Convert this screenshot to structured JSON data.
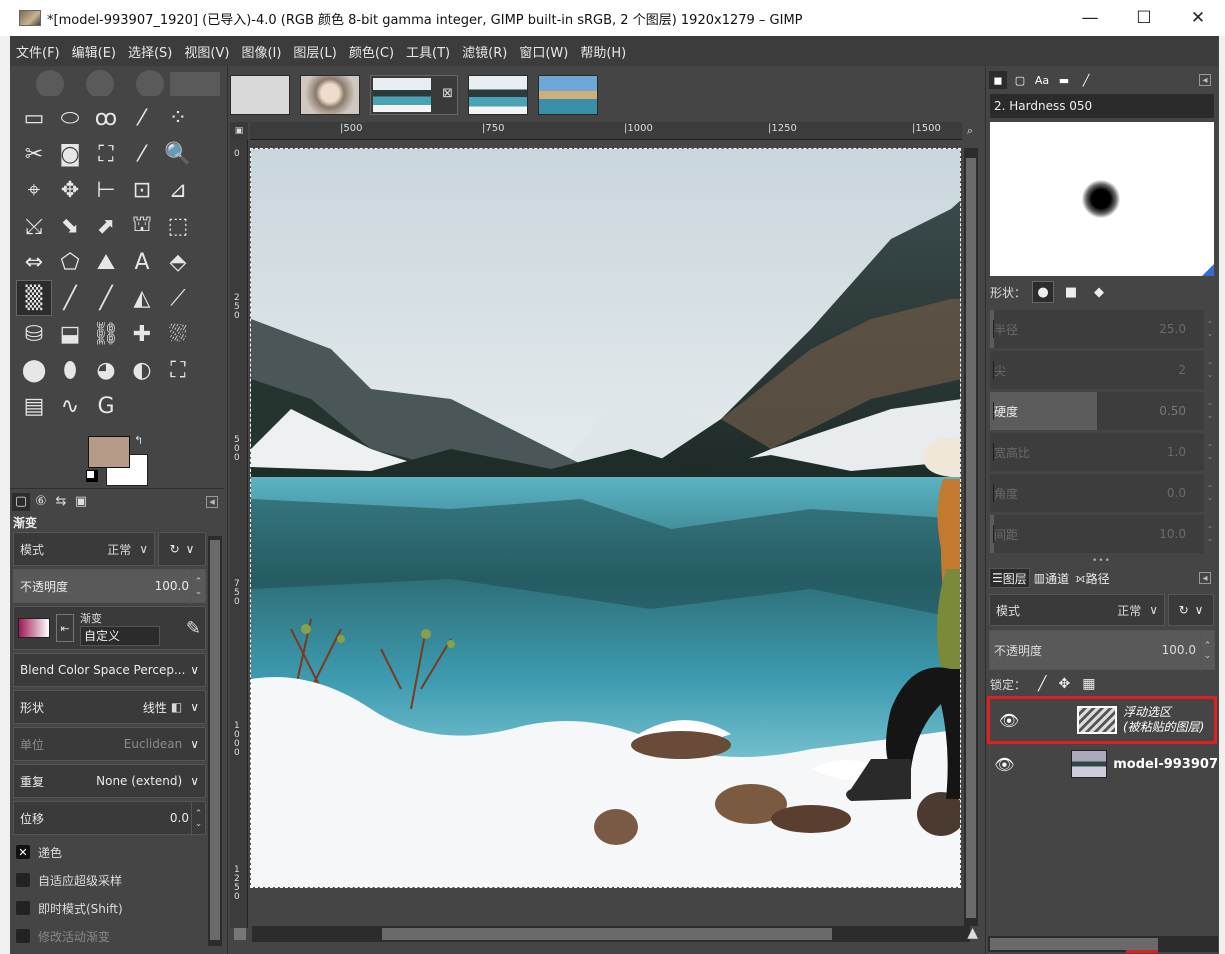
{
  "window": {
    "title": "*[model-993907_1920] (已导入)-4.0 (RGB 颜色 8-bit gamma integer, GIMP built-in sRGB, 2 个图层) 1920x1279 – GIMP",
    "minimize": "—",
    "maximize": "☐",
    "close": "✕"
  },
  "menubar": [
    "文件(F)",
    "编辑(E)",
    "选择(S)",
    "视图(V)",
    "图像(I)",
    "图层(L)",
    "颜色(C)",
    "工具(T)",
    "滤镜(R)",
    "窗口(W)",
    "帮助(H)"
  ],
  "toolbox": {
    "tools": [
      "▭",
      "⬭",
      "ꝏ",
      "⁄",
      "⁘",
      "✂",
      "◙",
      "⛶",
      "⁄",
      "🔍",
      "⌖",
      "✥",
      "⊢",
      "⊡",
      "⊿",
      "⤩",
      "⬊",
      "⬈",
      "⛫",
      "⬚",
      "⇔",
      "⬠",
      "⛰",
      "A",
      "⬘",
      "▒",
      "╱",
      "╱",
      "◭",
      "⟋",
      "⛁",
      "⬓",
      "⛓",
      "✚",
      "⛆",
      "⬤",
      "⬮",
      "◕",
      "◐",
      "⛶",
      "▤",
      "∿",
      "G"
    ],
    "active_tool_index": 25,
    "fg_color": "#b59a88",
    "bg_color": "#ffffff",
    "swap_icon": "↰"
  },
  "tool_options": {
    "tabs": [
      "▢",
      "⑥",
      "⇆",
      "▣"
    ],
    "menu_arrow": "◂",
    "title": "渐变",
    "mode_label": "模式",
    "mode_value": "正常",
    "opacity_label": "不透明度",
    "opacity_value": "100.0",
    "gradient_label": "渐变",
    "gradient_value": "自定义",
    "blend_space": "Blend Color Space Percep...",
    "shape_label": "形状",
    "shape_value": "线性",
    "metric_label": "单位",
    "metric_value": "Euclidean",
    "repeat_label": "重复",
    "repeat_value": "None (extend)",
    "offset_label": "位移",
    "offset_value": "0.0",
    "checkboxes": [
      {
        "label": "递色",
        "checked": true
      },
      {
        "label": "自适应超级采样",
        "checked": false
      },
      {
        "label": "即时模式(Shift)",
        "checked": false
      },
      {
        "label": "修改活动渐变",
        "checked": false
      }
    ]
  },
  "image_tabs": {
    "close_icon": "⊠"
  },
  "rulers": {
    "top": [
      "|500",
      "|750",
      "|1000",
      "|1250",
      "|1500"
    ],
    "left": [
      "0",
      "250",
      "500",
      "750",
      "1000",
      "1250"
    ]
  },
  "brushes": {
    "brush_name": "2. Hardness 050",
    "shape_label": "形状：",
    "sliders": [
      {
        "label": "半径",
        "value": "25.0",
        "active": false,
        "fill": 0.02
      },
      {
        "label": "尖",
        "value": "2",
        "active": false,
        "fill": 0
      },
      {
        "label": "硬度",
        "value": "0.50",
        "active": true,
        "fill": 0.5
      },
      {
        "label": "宽高比",
        "value": "1.0",
        "active": false,
        "fill": 0
      },
      {
        "label": "角度",
        "value": "0.0",
        "active": false,
        "fill": 0
      },
      {
        "label": "间距",
        "value": "10.0",
        "active": false,
        "fill": 0.02
      }
    ]
  },
  "layers": {
    "tabs": [
      "图层",
      "通道",
      "路径"
    ],
    "tab_icons": [
      "☰",
      "▥",
      "⟗"
    ],
    "mode_label": "模式",
    "mode_value": "正常",
    "opacity_label": "不透明度",
    "opacity_value": "100.0",
    "lock_label": "锁定：",
    "lock_icons": [
      "╱",
      "✥",
      "▦"
    ],
    "items": [
      {
        "name_line1": "浮动选区",
        "name_line2": "(被粘贴的图层)",
        "selected": true,
        "italic": true
      },
      {
        "name_line1": "model-993907",
        "name_line2": "",
        "selected": false,
        "italic": false
      }
    ]
  },
  "icons": {
    "chevron": "∨",
    "reset": "↻",
    "eye": "👁"
  }
}
